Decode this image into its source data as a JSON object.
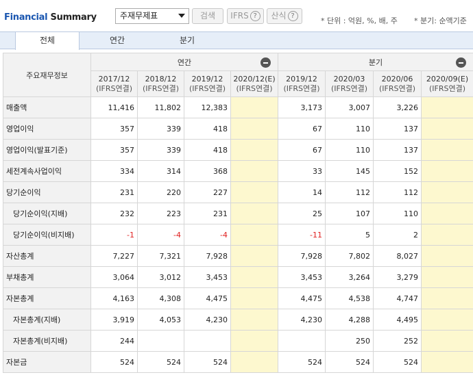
{
  "header": {
    "title_part1": "Financial",
    "title_part2": "Summary",
    "select_value": "주재무제표",
    "search_label": "검색",
    "ifrs_label": "IFRS",
    "calc_label": "산식",
    "help_glyph": "?",
    "unit_note": "* 단위 : 억원, %, 배, 주",
    "period_note": "* 분기: 순액기준"
  },
  "tabs": [
    "전체",
    "연간",
    "분기"
  ],
  "table": {
    "corner_label": "주요재무정보",
    "group_annual": "연간",
    "group_quarter": "분기",
    "columns": [
      {
        "period": "2017/12",
        "basis": "(IFRS연결)"
      },
      {
        "period": "2018/12",
        "basis": "(IFRS연결)"
      },
      {
        "period": "2019/12",
        "basis": "(IFRS연결)"
      },
      {
        "period": "2020/12(E)",
        "basis": "(IFRS연결)"
      },
      {
        "period": "2019/12",
        "basis": "(IFRS연결)"
      },
      {
        "period": "2020/03",
        "basis": "(IFRS연결)"
      },
      {
        "period": "2020/06",
        "basis": "(IFRS연결)"
      },
      {
        "period": "2020/09(E)",
        "basis": "(IFRS연결)"
      }
    ],
    "rows": [
      {
        "label": "매출액",
        "values": [
          "11,416",
          "11,802",
          "12,383",
          "",
          "3,173",
          "3,007",
          "3,226",
          ""
        ]
      },
      {
        "label": "영업이익",
        "values": [
          "357",
          "339",
          "418",
          "",
          "67",
          "110",
          "137",
          ""
        ]
      },
      {
        "label": "영업이익(발표기준)",
        "values": [
          "357",
          "339",
          "418",
          "",
          "67",
          "110",
          "137",
          ""
        ]
      },
      {
        "label": "세전계속사업이익",
        "values": [
          "334",
          "314",
          "368",
          "",
          "33",
          "145",
          "152",
          ""
        ]
      },
      {
        "label": "당기순이익",
        "values": [
          "231",
          "220",
          "227",
          "",
          "14",
          "112",
          "112",
          ""
        ]
      },
      {
        "label": "당기순이익(지배)",
        "values": [
          "232",
          "223",
          "231",
          "",
          "25",
          "107",
          "110",
          ""
        ]
      },
      {
        "label": "당기순이익(비지배)",
        "values": [
          "-1",
          "-4",
          "-4",
          "",
          "-11",
          "5",
          "2",
          ""
        ]
      },
      {
        "label": "자산총계",
        "values": [
          "7,227",
          "7,321",
          "7,928",
          "",
          "7,928",
          "7,802",
          "8,027",
          ""
        ]
      },
      {
        "label": "부채총계",
        "values": [
          "3,064",
          "3,012",
          "3,453",
          "",
          "3,453",
          "3,264",
          "3,279",
          ""
        ]
      },
      {
        "label": "자본총계",
        "values": [
          "4,163",
          "4,308",
          "4,475",
          "",
          "4,475",
          "4,538",
          "4,747",
          ""
        ]
      },
      {
        "label": "자본총계(지배)",
        "values": [
          "3,919",
          "4,053",
          "4,230",
          "",
          "4,230",
          "4,288",
          "4,495",
          ""
        ]
      },
      {
        "label": "자본총계(비지배)",
        "values": [
          "244",
          "",
          "",
          "",
          "",
          "250",
          "252",
          ""
        ]
      },
      {
        "label": "자본금",
        "values": [
          "524",
          "524",
          "524",
          "",
          "524",
          "524",
          "524",
          ""
        ]
      }
    ]
  }
}
